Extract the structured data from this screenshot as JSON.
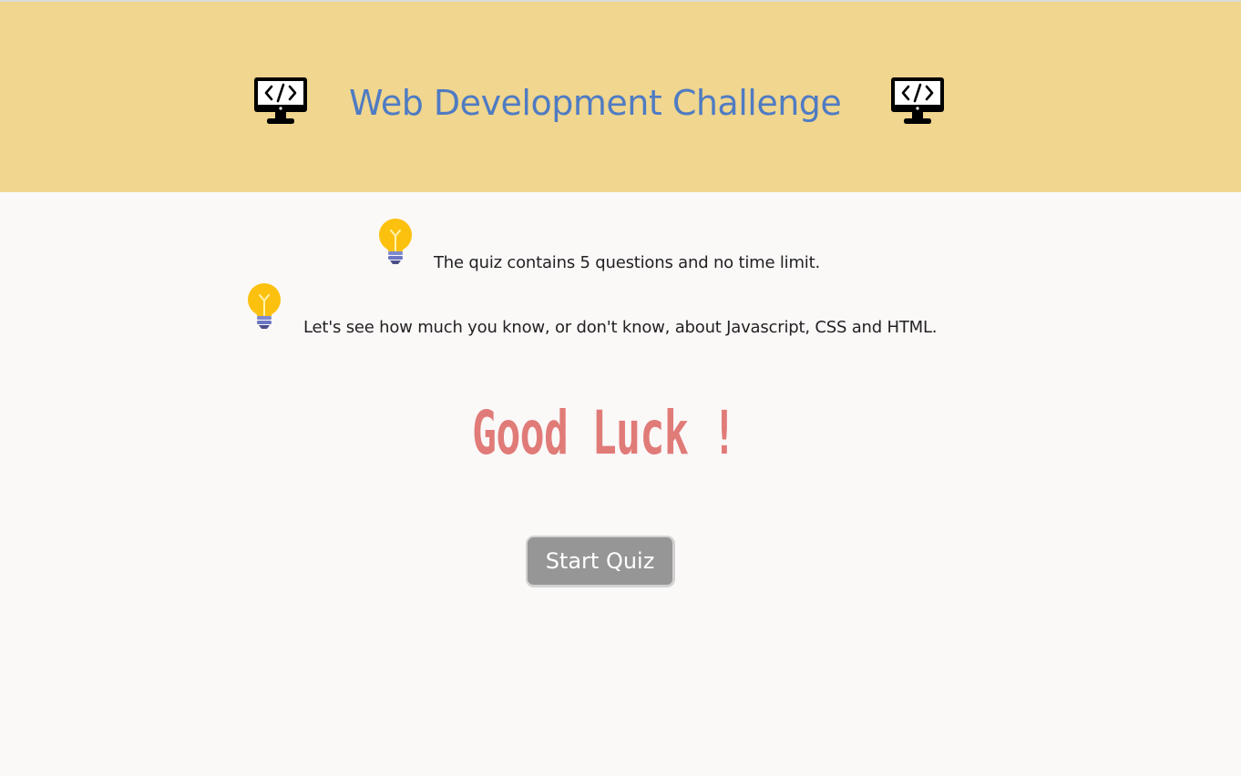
{
  "header": {
    "title": "Web Development Challenge",
    "background": "#f0d68e",
    "title_color": "#4f7bc3",
    "left_icon": "code-monitor-icon",
    "right_icon": "code-monitor-icon"
  },
  "info": {
    "icon": "lightbulb-icon",
    "lines": [
      "The quiz contains 5 questions and no time limit.",
      "Let's see how much you know, or don't know, about Javascript, CSS and HTML."
    ]
  },
  "good_luck": {
    "text": "Good Luck !",
    "color": "#e07b78"
  },
  "start_button": {
    "label": "Start Quiz",
    "background": "#969696"
  }
}
